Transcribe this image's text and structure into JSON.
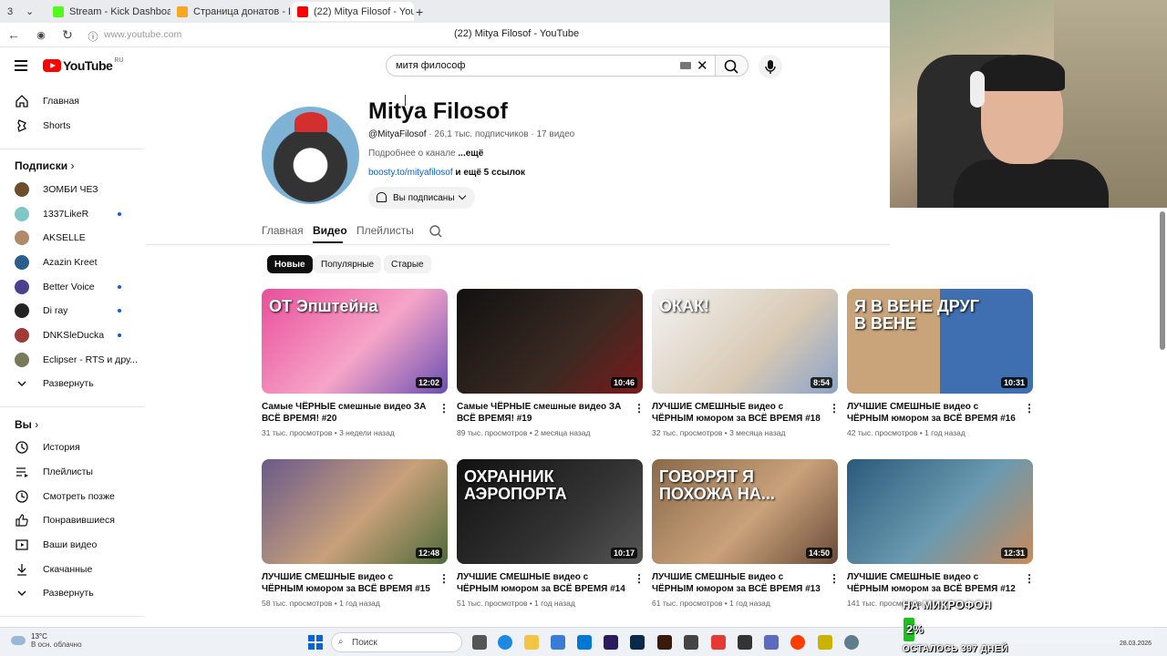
{
  "browser": {
    "tab_count": "3",
    "tabs": [
      {
        "label": "Stream - Kick Dashboard",
        "color": "#53fc18"
      },
      {
        "label": "Страница донатов - Dona",
        "color": "#f5a623"
      },
      {
        "label": "(22) Mitya Filosof - You",
        "color": "#ff0000"
      }
    ],
    "url": "www.youtube.com",
    "page_title": "(22) Mitya Filosof - YouTube"
  },
  "youtube": {
    "logo_text": "YouTube",
    "logo_region": "RU",
    "search_query": "митя философ"
  },
  "sidebar": {
    "main": [
      {
        "label": "Главная",
        "icon": "home-icon"
      },
      {
        "label": "Shorts",
        "icon": "shorts-icon"
      }
    ],
    "subscriptions_title": "Подписки",
    "subscriptions": [
      {
        "label": "ЗОМБИ ЧЕЗ",
        "color": "#6b4f2a",
        "dot": false
      },
      {
        "label": "1337LikeR",
        "color": "#7fc6c6",
        "dot": true
      },
      {
        "label": "AKSELLE",
        "color": "#b08968",
        "dot": false
      },
      {
        "label": "Azazin Kreet",
        "color": "#2c5d8f",
        "dot": false
      },
      {
        "label": "Better Voice",
        "color": "#4b3f8f",
        "dot": true
      },
      {
        "label": "Di ray",
        "color": "#222222",
        "dot": true
      },
      {
        "label": "DNKSleDucka",
        "color": "#a33a3a",
        "dot": true
      },
      {
        "label": "Eclipser - RTS и дру...",
        "color": "#7a7a5a",
        "dot": false
      }
    ],
    "expand_subs_label": "Развернуть",
    "you_title": "Вы",
    "you_items": [
      {
        "label": "История",
        "icon": "history-icon"
      },
      {
        "label": "Плейлисты",
        "icon": "playlists-icon"
      },
      {
        "label": "Смотреть позже",
        "icon": "watch-later-icon"
      },
      {
        "label": "Понравившиеся",
        "icon": "like-icon"
      },
      {
        "label": "Ваши видео",
        "icon": "your-videos-icon"
      },
      {
        "label": "Скачанные",
        "icon": "download-icon"
      }
    ],
    "expand_you_label": "Развернуть"
  },
  "channel": {
    "name": "Mitya Filosof",
    "handle": "@MityaFilosof",
    "stats": " · 26,1 тыс. подписчиков · 17 видео",
    "desc": "Подробнее о канале ",
    "desc_more": "...ещё",
    "link": "boosty.to/mityafilosof",
    "link_more": " и ещё 5 ссылок",
    "subscribed_label": "Вы подписаны",
    "tabs": [
      "Главная",
      "Видео",
      "Плейлисты"
    ],
    "active_tab": 1
  },
  "chips": [
    {
      "label": "Новые",
      "active": true
    },
    {
      "label": "Популярные",
      "active": false
    },
    {
      "label": "Старые",
      "active": false
    }
  ],
  "videos": [
    {
      "title": "Самые ЧЁРНЫЕ смешные видео ЗА ВСЁ ВРЕМЯ! #20",
      "views": "31 тыс. просмотров",
      "age": "3 недели назад",
      "duration": "12:02",
      "caption": "ОТ Эпштейна",
      "bg": "linear-gradient(135deg,#e94e9b,#f6a5c8 55%,#6a4fb3)"
    },
    {
      "title": "Самые ЧЁРНЫЕ смешные видео ЗА ВСЁ ВРЕМЯ! #19",
      "views": "89 тыс. просмотров",
      "age": "2 месяца назад",
      "duration": "10:46",
      "caption": "",
      "bg": "linear-gradient(135deg,#111,#3a2a22 60%,#7a1a1a)"
    },
    {
      "title": "ЛУЧШИЕ СМЕШНЫЕ видео с ЧЁРНЫМ юмором за ВСЁ ВРЕМЯ #18",
      "views": "32 тыс. просмотров",
      "age": "3 месяца назад",
      "duration": "8:54",
      "caption": "ОКАК!",
      "bg": "linear-gradient(135deg,#f3f3f3,#d8c9b4 60%,#8aa3c7)"
    },
    {
      "title": "ЛУЧШИЕ СМЕШНЫЕ видео с ЧЁРНЫМ юмором за ВСЁ ВРЕМЯ #16",
      "views": "42 тыс. просмотров",
      "age": "1 год назад",
      "duration": "10:31",
      "caption": "Я В ВЕНЕ  ДРУГ В ВЕНЕ",
      "bg": "linear-gradient(90deg,#c9a47a 0 50%,#3f6fb0 50% 100%)"
    },
    {
      "title": "ЛУЧШИЕ СМЕШНЫЕ видео с ЧЁРНЫМ юмором за ВСЁ ВРЕМЯ #15",
      "views": "58 тыс. просмотров",
      "age": "1 год назад",
      "duration": "12:48",
      "caption": "",
      "bg": "linear-gradient(135deg,#6a5a8a,#c8a07a 55%,#4d6a3a)"
    },
    {
      "title": "ЛУЧШИЕ СМЕШНЫЕ видео с ЧЁРНЫМ юмором за ВСЁ ВРЕМЯ #14",
      "views": "51 тыс. просмотров",
      "age": "1 год назад",
      "duration": "10:17",
      "caption": "ОХРАННИК АЭРОПОРТА",
      "bg": "linear-gradient(135deg,#111,#333 60%,#555)"
    },
    {
      "title": "ЛУЧШИЕ СМЕШНЫЕ видео с ЧЁРНЫМ юмором за ВСЁ ВРЕМЯ #13",
      "views": "61 тыс. просмотров",
      "age": "1 год назад",
      "duration": "14:50",
      "caption": "ГОВОРЯТ Я ПОХОЖА НА...",
      "bg": "linear-gradient(135deg,#8a6a4a,#c9a27a 55%,#6a4a3a)"
    },
    {
      "title": "ЛУЧШИЕ СМЕШНЫЕ видео с ЧЁРНЫМ юмором за ВСЁ ВРЕМЯ #12",
      "views": "141 тыс. просмотров",
      "age": "1 год назад",
      "duration": "12:31",
      "caption": "",
      "bg": "linear-gradient(135deg,#2a5a7a,#6a9ab0 55%,#c98a5a)"
    }
  ],
  "taskbar": {
    "temp": "13°C",
    "weather": "В осн. облачно",
    "search_placeholder": "Поиск",
    "date": "28.03.2026"
  },
  "stream_overlay": {
    "mic_label": "НА МИКРОФОН",
    "percent": "2%",
    "progress": 0.02,
    "days_left": "ОСТАЛОСЬ 397 ДНЕЙ"
  }
}
